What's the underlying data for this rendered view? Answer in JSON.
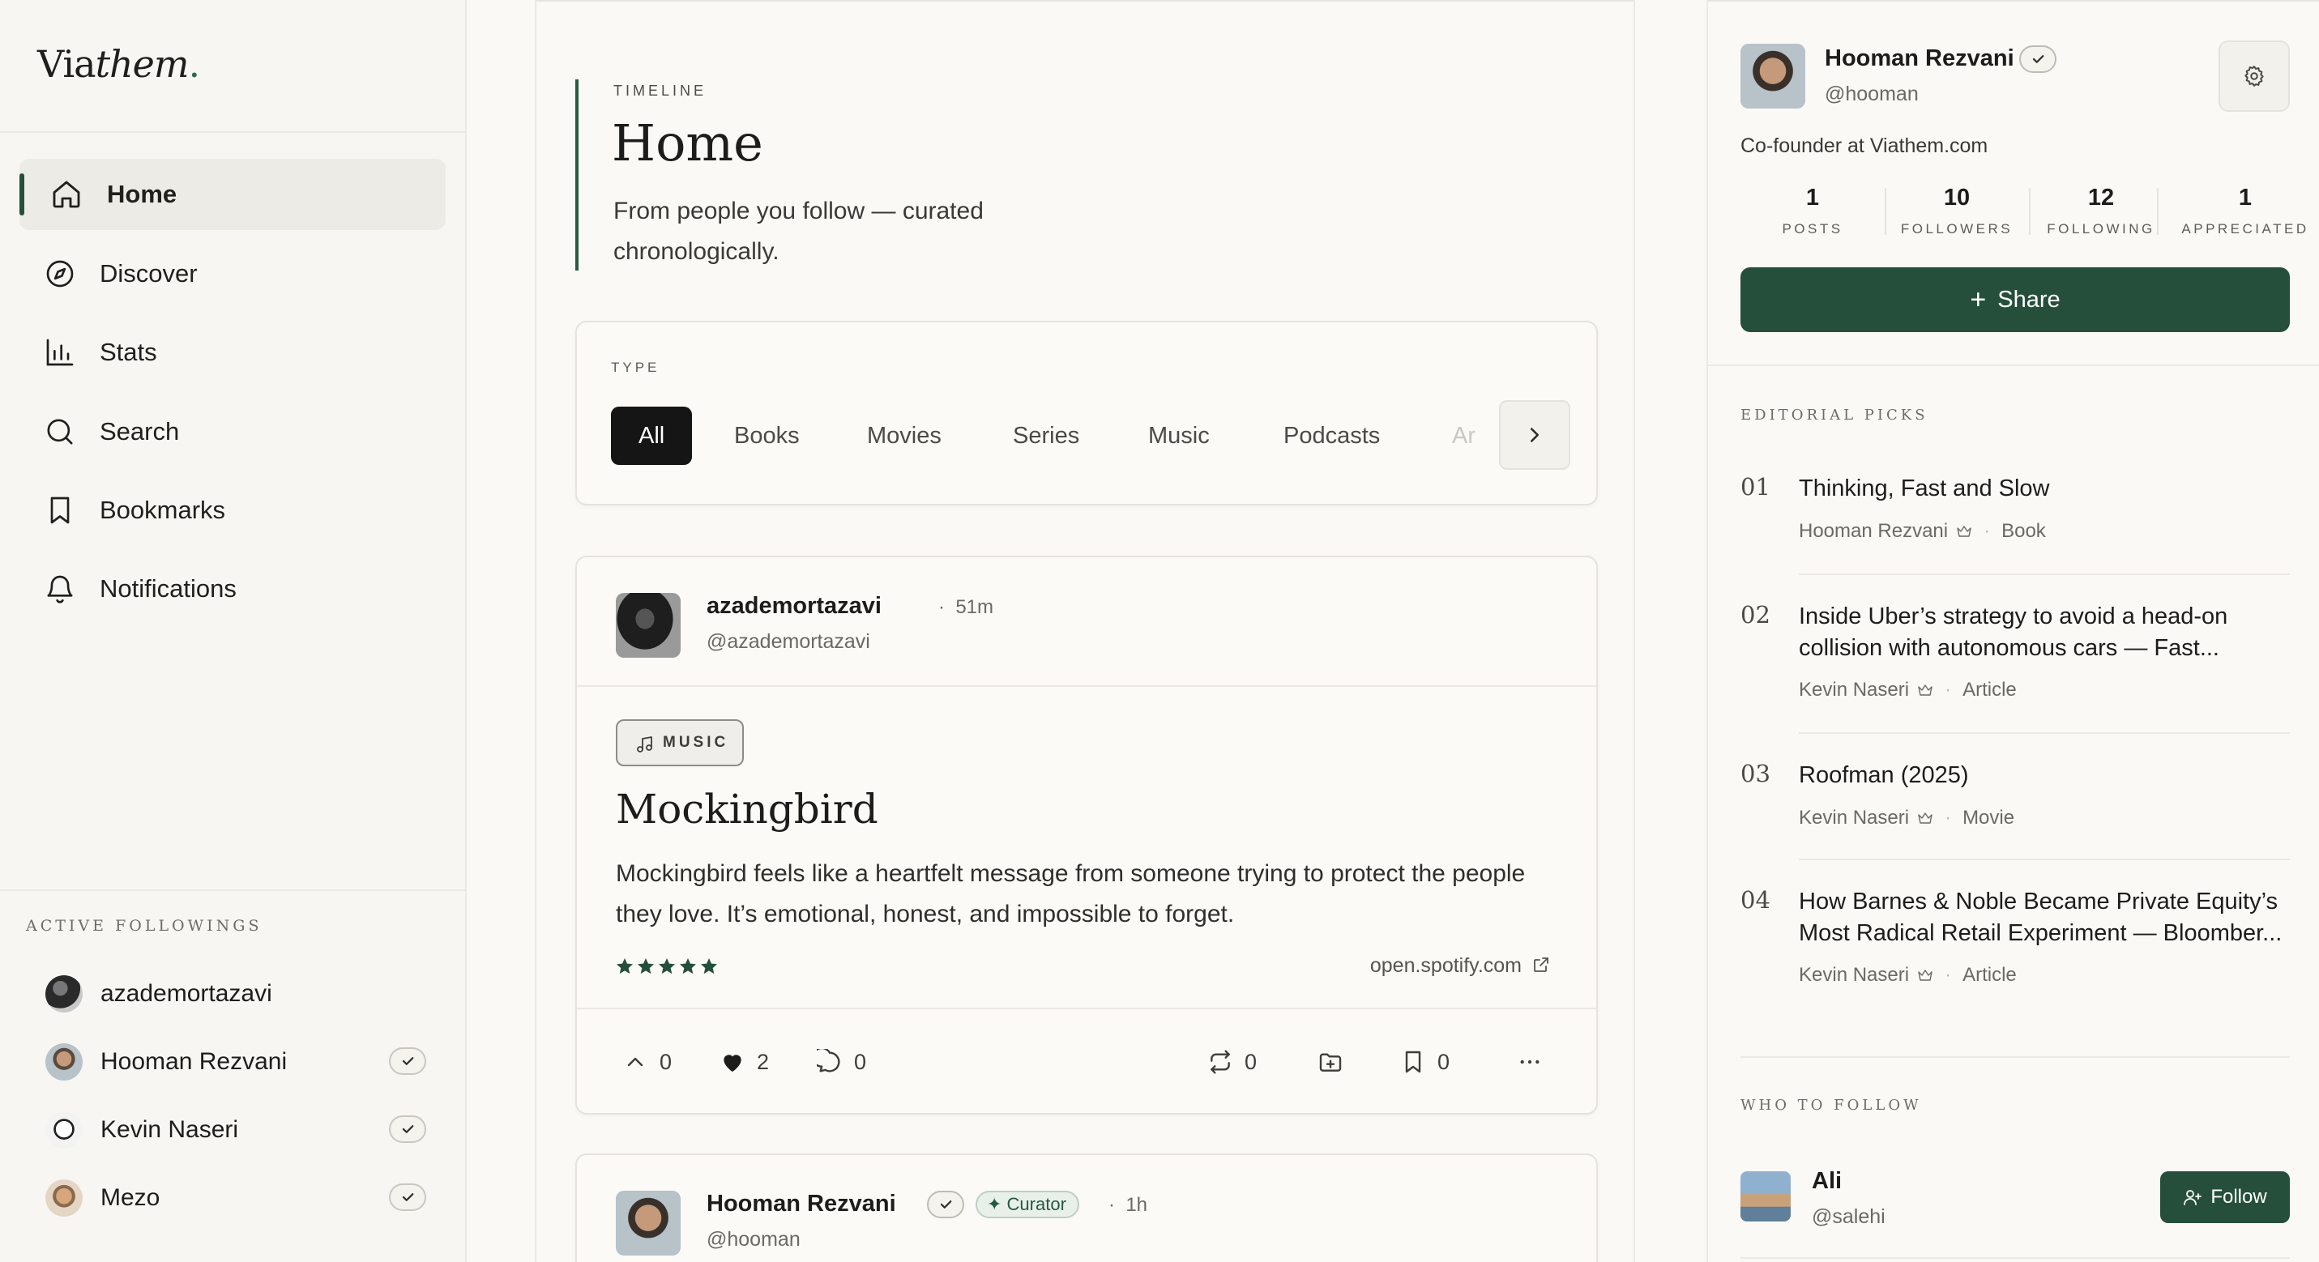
{
  "brand": {
    "pre": "Via",
    "post": "them",
    "dot": "."
  },
  "nav": [
    {
      "label": "Home",
      "icon": "home-icon",
      "active": true
    },
    {
      "label": "Discover",
      "icon": "compass-icon"
    },
    {
      "label": "Stats",
      "icon": "bar-chart-icon"
    },
    {
      "label": "Search",
      "icon": "search-icon"
    },
    {
      "label": "Bookmarks",
      "icon": "bookmark-icon"
    },
    {
      "label": "Notifications",
      "icon": "bell-icon"
    }
  ],
  "active_followings": {
    "title": "ACTIVE FOLLOWINGS",
    "items": [
      {
        "name": "azademortazavi",
        "verified": false
      },
      {
        "name": "Hooman Rezvani",
        "verified": true
      },
      {
        "name": "Kevin Naseri",
        "verified": true
      },
      {
        "name": "Mezo",
        "verified": true
      }
    ]
  },
  "header": {
    "kicker": "TIMELINE",
    "title": "Home",
    "subtitle": "From people you follow — curated chronologically."
  },
  "type_filter": {
    "label": "TYPE",
    "chips": [
      "All",
      "Books",
      "Movies",
      "Series",
      "Music",
      "Podcasts",
      "Ar"
    ],
    "selected": "All"
  },
  "post1": {
    "user": "azademortazavi",
    "time": "51m",
    "handle": "@azademortazavi",
    "tag": "MUSIC",
    "title": "Mockingbird",
    "body": "Mockingbird feels like a heartfelt message from someone trying to protect the people they love. It’s emotional, honest, and impossible to forget.",
    "rating": 5,
    "link": "open.spotify.com",
    "actions": {
      "upvotes": "0",
      "likes": "2",
      "comments": "0",
      "reposts": "0",
      "bookmarks": "0"
    }
  },
  "post2": {
    "user": "Hooman Rezvani",
    "badge": "Curator",
    "time": "1h",
    "handle": "@hooman"
  },
  "profile": {
    "name": "Hooman Rezvani",
    "handle": "@hooman",
    "bio": "Co-founder at Viathem.com",
    "stats": [
      {
        "value": "1",
        "label": "POSTS"
      },
      {
        "value": "10",
        "label": "FOLLOWERS"
      },
      {
        "value": "12",
        "label": "FOLLOWING"
      },
      {
        "value": "1",
        "label": "APPRECIATED"
      }
    ],
    "share_label": "Share"
  },
  "editorial": {
    "title": "EDITORIAL PICKS",
    "items": [
      {
        "num": "01",
        "title": "Thinking, Fast and Slow",
        "author": "Hooman Rezvani",
        "type": "Book"
      },
      {
        "num": "02",
        "title": "Inside Uber’s strategy to avoid a head-on",
        "title2": "collision with autonomous cars — Fast...",
        "author": "Kevin Naseri",
        "type": "Article"
      },
      {
        "num": "03",
        "title": "Roofman (2025)",
        "author": "Kevin Naseri",
        "type": "Movie"
      },
      {
        "num": "04",
        "title": "How Barnes & Noble Became Private Equity’s",
        "title2": "Most Radical Retail Experiment — Bloomber...",
        "author": "Kevin Naseri",
        "type": "Article"
      }
    ]
  },
  "who_to_follow": {
    "title": "WHO TO FOLLOW",
    "name": "Ali",
    "handle": "@salehi",
    "button": "Follow"
  },
  "colors": {
    "accent": "#264f3b",
    "bg": "#faf9f6",
    "selected_chip": "#151515"
  }
}
